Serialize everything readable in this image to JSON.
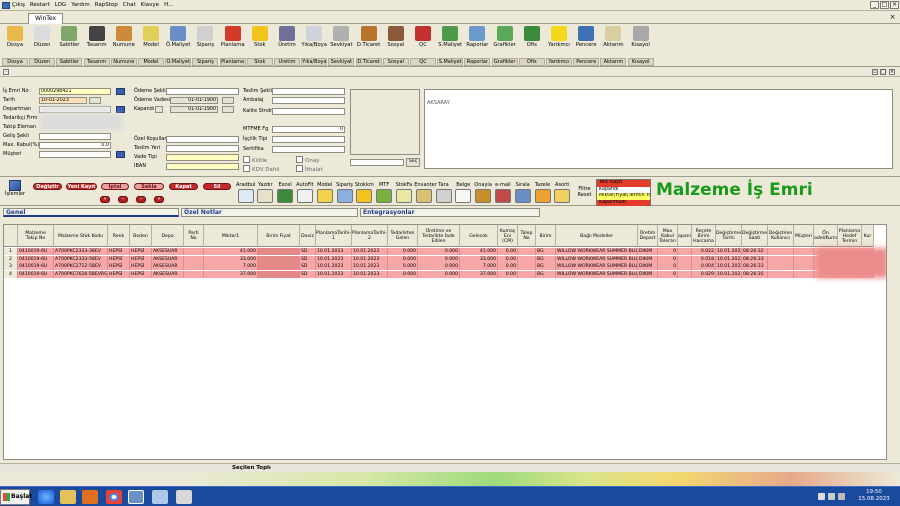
{
  "menubar": {
    "items": [
      "Çıkış",
      "Restart",
      "LOG",
      "Yardım",
      "RapStop",
      "Chat",
      "Klavye",
      "H..."
    ]
  },
  "window": {
    "tab_title": "WinTex"
  },
  "toolbar": {
    "buttons": [
      {
        "label": "Dosya",
        "sub": "Dosya",
        "color": "#e9b84a"
      },
      {
        "label": "Düzen",
        "sub": "Düzen",
        "color": "#dcdcdc"
      },
      {
        "label": "Sabitler",
        "sub": "Sabitler",
        "color": "#7fa86a"
      },
      {
        "label": "Tasarım",
        "sub": "Tasarım",
        "color": "#444444"
      },
      {
        "label": "Numune",
        "sub": "Numune",
        "color": "#cc8a3a"
      },
      {
        "label": "Model",
        "sub": "Model",
        "color": "#e0d058"
      },
      {
        "label": "Ö.Maliyet",
        "sub": "Ö.Maliyet",
        "color": "#6a8fc8"
      },
      {
        "label": "Sipariş",
        "sub": "Sipariş",
        "color": "#d0d0d0"
      },
      {
        "label": "Planlama",
        "sub": "Planlama",
        "color": "#d23a2a"
      },
      {
        "label": "Stok",
        "sub": "Stok",
        "color": "#f2c21d"
      },
      {
        "label": "Üretim",
        "sub": "Üretim",
        "color": "#6f6f9a"
      },
      {
        "label": "Yıka/Boya",
        "sub": "Yıka/Boya",
        "color": "#cfd4dc"
      },
      {
        "label": "Sevkiyat",
        "sub": "Sevkiyat",
        "color": "#b0b0b0"
      },
      {
        "label": "D.Ticaret",
        "sub": "D.Ticaret",
        "color": "#b8742c"
      },
      {
        "label": "Sosyal",
        "sub": "Sosyal",
        "color": "#8a5a3a"
      },
      {
        "label": "QC",
        "sub": "QC",
        "color": "#c43030"
      },
      {
        "label": "S.Maliyet",
        "sub": "S.Maliyet",
        "color": "#4f9a4a"
      },
      {
        "label": "Raporlar",
        "sub": "Raporlar",
        "color": "#6a9acb"
      },
      {
        "label": "Grafikler",
        "sub": "Grafikler",
        "color": "#5aa85a"
      },
      {
        "label": "Ofis",
        "sub": "Ofis",
        "color": "#3b8a3b"
      },
      {
        "label": "Yardımcı",
        "sub": "Yardımcı",
        "color": "#f4d81c"
      },
      {
        "label": "Pencere",
        "sub": "Pencere",
        "color": "#3f6fb5"
      },
      {
        "label": "Aktarım",
        "sub": "Aktarım",
        "color": "#d8cfa0"
      },
      {
        "label": "Kısayol",
        "sub": "Kısayol",
        "color": "#a8a8a8"
      }
    ]
  },
  "form": {
    "is_emri_no_label": "İş Emri No",
    "is_emri_no_value": "0000298421",
    "tarih_label": "Tarih",
    "tarih_value": "10-01-2023",
    "departman_label": "Departman",
    "tedarikci_firma_label": "Tedarikçi Firm",
    "takip_eleman_label": "Takip Eleman",
    "gelis_sekli_label": "Geliş Şekli",
    "max_kabul_label": "Max. Kabul(%)",
    "max_kabul_value": "0,0",
    "musteri_label": "Müşteri",
    "odeme_sekli_label": "Ödeme Şekli",
    "odeme_vadesi_label": "Ödeme Vadesi",
    "odeme_vadesi_date": "01-01-1900",
    "kapandi_label": "Kapandı",
    "kapandi_date": "01-01-1900",
    "ozel_kosullar_label": "Özel Koşullar",
    "teslim_yeri_label": "Teslim Yeri",
    "vade_tipi_label": "Vade Tipi",
    "iban_label": "IBAN",
    "teslim_sekli_label": "Teslim Şekli",
    "ambalaj_label": "Ambalaj",
    "kalite_std_label": "Kalite Stndrt",
    "mtfme_fg_label": "MTFME Fg",
    "mtfme_fg_value": "0",
    "iscilik_tipi_label": "İşçilik Tipi",
    "sertifika_label": "Sertifika",
    "kilitle_label": "Kilitle",
    "kdv_dahil_label": "KDV Dahil",
    "onay_label": "Onay",
    "ithalat_label": "İthalat",
    "note_text": "AKSARAY",
    "small_button_label": "Seç"
  },
  "actions": {
    "degistir": "Değiştir",
    "yeni_kayit": "Yeni Kayıt",
    "iptal": "İptal",
    "sakla": "Sakla",
    "kapat": "Kapat",
    "sil": "Sil",
    "islemler": "İşlemler",
    "tools": [
      "Aradbul",
      "Yazdır",
      "Excel",
      "AutoFit",
      "Model",
      "Sipariş",
      "Stokkm",
      "MTF",
      "StokFa",
      "Envanter",
      "Tara",
      "Belge",
      "Onayla",
      "e-mail",
      "Sırala",
      "Tazele",
      "Asorti"
    ],
    "filtre_reset": "Filtre Reset"
  },
  "legend": [
    {
      "text": "Yeni Kayıt",
      "color": "#e23b2b"
    },
    {
      "text": "Kapandı",
      "color": "#ffffff"
    },
    {
      "text": "Miktar/Fiyat/Termin Yok",
      "color": "#ffff66"
    },
    {
      "text": "Kapanmadı",
      "color": "#e23b2b"
    }
  ],
  "page_title": "Malzeme İş Emri",
  "sections": {
    "genel": "Genel",
    "ozel_notlar": "Özel Notlar",
    "entegrasyonlar": "Entegrasyonlar"
  },
  "table": {
    "headers": [
      "",
      "Malzeme Takip No",
      "Malzeme Stok Kodu",
      "Renk",
      "Beden",
      "Depo",
      "Parti No",
      "Miktar1",
      "Birim Fiyat",
      "Doviz",
      "PlanlamaTarihi-1",
      "PlanlamaTarihi-2",
      "Tedarikten Gelen",
      "Üretime ve Tedarikte İade Edilen",
      "Gelecek",
      "Kumaş Eni (CM)",
      "Talep No",
      "Birim",
      "Bağlı Modeller",
      "Üretim Depart",
      "Max Kabul Toleran",
      "Kapandı",
      "Reçete Birim Harcama",
      "Değiştirme Tarihi",
      "Değiştirme Saati",
      "Değiştiren Kullanıcı",
      "Müşteri",
      "Ön Model/Kumaş",
      "Planlama Hedef Termin",
      "Kur"
    ],
    "rows": [
      [
        "1",
        "0410019-6U",
        "A700PKC2333-38EV",
        "HEPSİ",
        "HEPSİ",
        "AKSESUAR",
        "",
        "41.000",
        "",
        "SD",
        "10.01.2023",
        "10.01.2023",
        "0.000",
        "0.000",
        "41.000",
        "0.00",
        "",
        "BG",
        "WILLOW WORKWEAR SUMMER BLUE OL",
        "DIKIM",
        "0",
        "",
        "0.022",
        "10.01.2023",
        "08:26:32",
        "",
        "",
        "",
        "",
        ""
      ],
      [
        "2",
        "0410019-6U",
        "A700PKC2333-58EV",
        "HEPSİ",
        "HEPSİ",
        "AKSESUAR",
        "",
        "33.000",
        "",
        "SD",
        "10.01.2023",
        "10.01.2023",
        "0.000",
        "0.000",
        "33.000",
        "0.00",
        "",
        "BG",
        "WILLOW WORKWEAR SUMMER BLUE OL",
        "DIKIM",
        "0",
        "",
        "0.018",
        "10.01.2023",
        "08:26:33",
        "",
        "",
        "",
        "",
        ""
      ],
      [
        "3",
        "0410019-6U",
        "A700PKC2712-58EV",
        "HEPSİ",
        "HEPSİ",
        "AKSESUAR",
        "",
        "7.000",
        "",
        "SD",
        "10.01.2023",
        "10.01.2023",
        "0.000",
        "0.000",
        "7.000",
        "0.00",
        "",
        "BG",
        "WILLOW WORKWEAR SUMMER BLUE OL",
        "DIKIM",
        "0",
        "",
        "0.004",
        "10.01.2023",
        "08:26:33",
        "",
        "",
        "",
        "",
        ""
      ],
      [
        "4",
        "0410019-6U",
        "A700PKC7616-58EVRG",
        "HEPSİ",
        "HEPSİ",
        "AKSESUAR",
        "",
        "37.000",
        "",
        "SD",
        "10.01.2023",
        "10.01.2023",
        "0.000",
        "0.000",
        "37.000",
        "0.00",
        "",
        "BG",
        "WILLOW WORKWEAR SUMMER BLUE OL",
        "DIKIM",
        "0",
        "",
        "0.029",
        "10.01.2023",
        "08:26:35",
        "",
        "",
        "",
        "",
        ""
      ]
    ]
  },
  "footer": {
    "secilen_toplam": "Seçilen Toplı"
  },
  "taskbar": {
    "start_label": "Başlat",
    "time": "19:50",
    "date": "15.08.2023"
  }
}
